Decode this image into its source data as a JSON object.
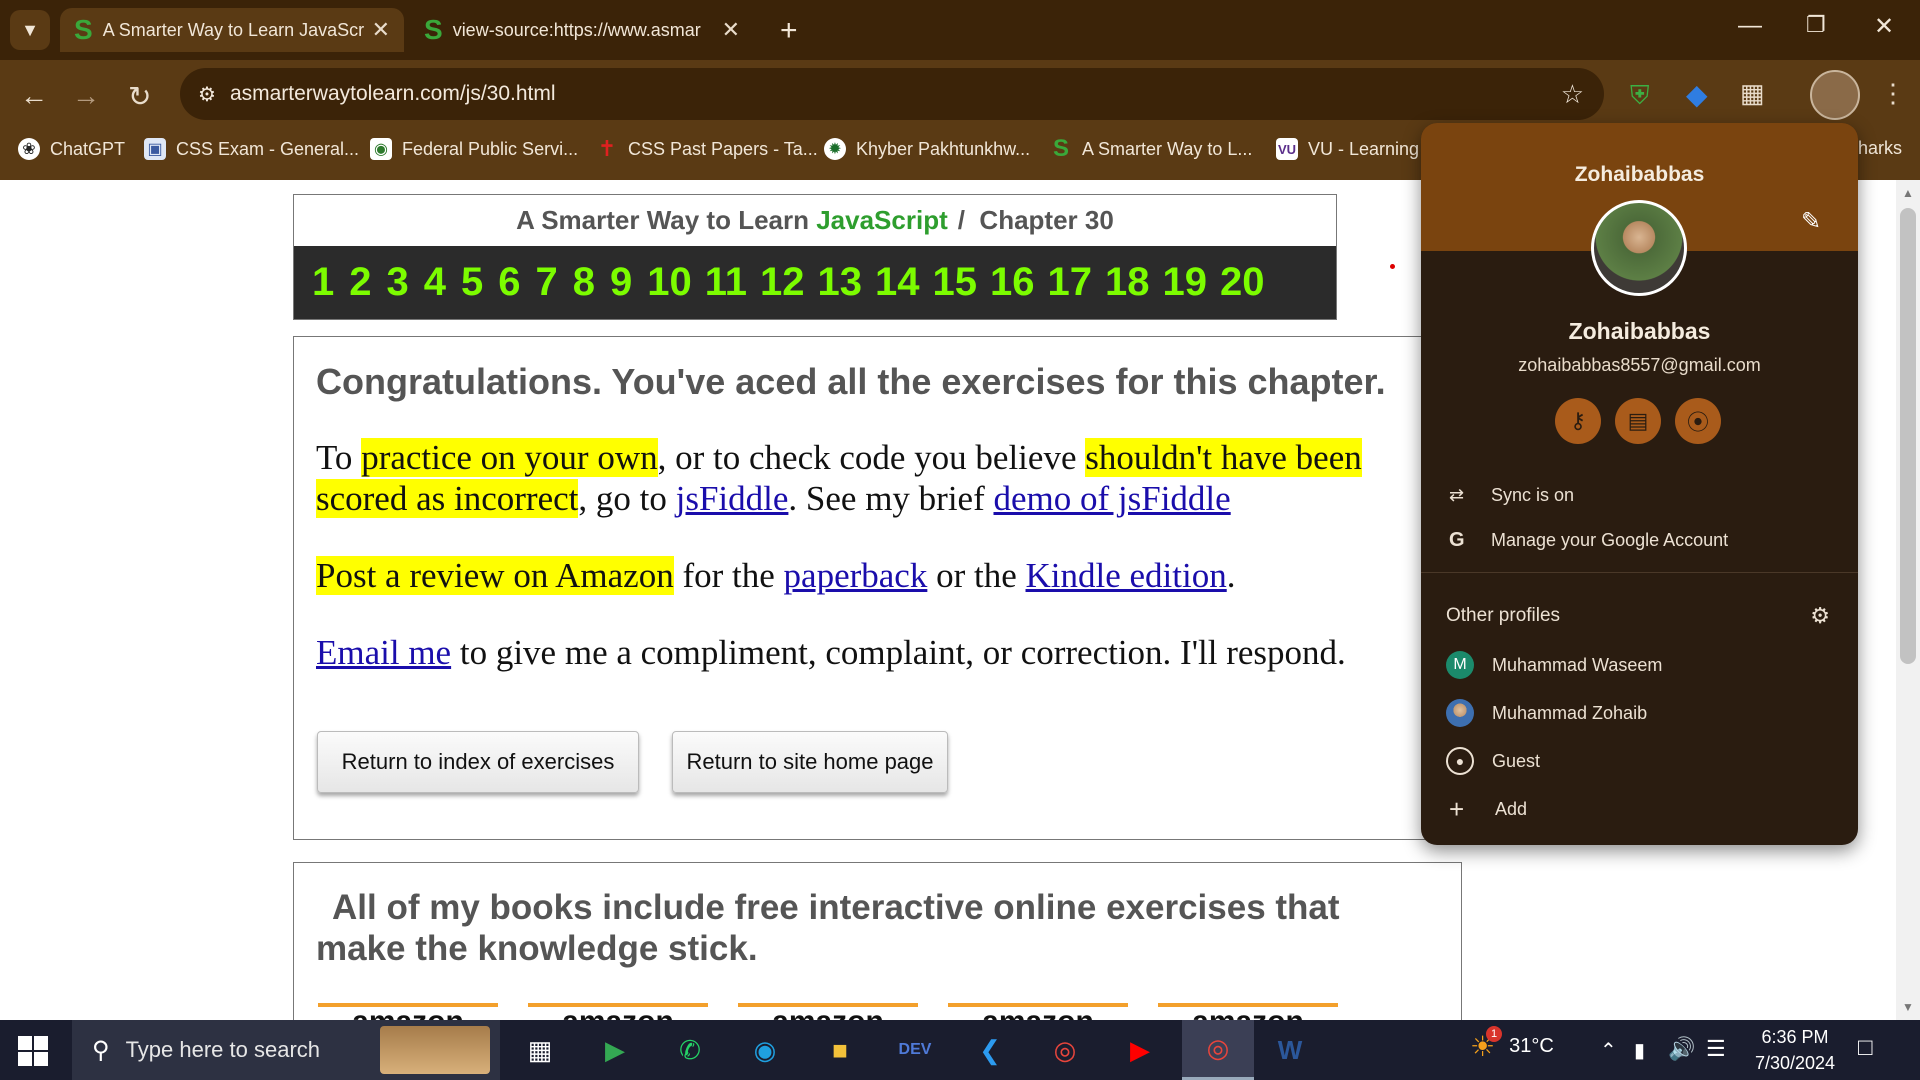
{
  "tabs": [
    {
      "title": "A Smarter Way to Learn JavaScr",
      "active": true
    },
    {
      "title": "view-source:https://www.asmar",
      "active": false
    }
  ],
  "toolbar": {
    "url": "asmarterwaytolearn.com/js/30.html",
    "back_icon": "back-arrow-icon",
    "forward_icon": "forward-arrow-icon",
    "reload_icon": "reload-icon"
  },
  "bookmarks": [
    {
      "label": "ChatGPT",
      "icon": "chatgpt-icon"
    },
    {
      "label": "CSS Exam - General...",
      "icon": "book-icon"
    },
    {
      "label": "Federal Public Servi...",
      "icon": "fpsc-icon"
    },
    {
      "label": "CSS Past Papers - Ta...",
      "icon": "pin-icon"
    },
    {
      "label": "Khyber Pakhtunkhw...",
      "icon": "seal-icon"
    },
    {
      "label": "A Smarter Way to L...",
      "icon": "s-icon"
    },
    {
      "label": "VU - Learning",
      "icon": "vu-icon"
    },
    {
      "label": "harks",
      "icon": ""
    }
  ],
  "header": {
    "title_prefix": "A Smarter Way to Learn ",
    "title_js": "JavaScript",
    "title_suffix": "/  Chapter 30",
    "chapters": [
      "1",
      "2",
      "3",
      "4",
      "5",
      "6",
      "7",
      "8",
      "9",
      "10",
      "11",
      "12",
      "13",
      "14",
      "15",
      "16",
      "17",
      "18",
      "19",
      "20"
    ]
  },
  "content": {
    "heading": "Congratulations. You've aced all the exercises for this chapter.",
    "p1_a": "To ",
    "p1_hl1": "practice on your own",
    "p1_b": ", or to check code you believe ",
    "p1_hl2": "shouldn't have been scored as incorrect",
    "p1_c": ", go to ",
    "p1_link1": "jsFiddle",
    "p1_d": ". See my brief ",
    "p1_link2": "demo of jsFiddle",
    "p2_hl": "Post a review on Amazon",
    "p2_a": " for the ",
    "p2_link1": "paperback",
    "p2_b": " or the ",
    "p2_link2": "Kindle edition",
    "p2_c": ".",
    "p3_link": "Email me",
    "p3_a": " to give me a compliment, complaint, or correction. I'll respond.",
    "btn_index": "Return to index of exercises",
    "btn_home": "Return to site home page"
  },
  "books": {
    "heading": "All of my books include free interactive online exercises that make the knowledge stick.",
    "amazon_label": "amazon"
  },
  "profile": {
    "header_name": "Zohaibabbas",
    "name": "Zohaibabbas",
    "email": "zohaibabbas8557@gmail.com",
    "sync": "Sync is on",
    "manage": "Manage your Google Account",
    "other_profiles": "Other profiles",
    "profiles": [
      {
        "initial": "M",
        "name": "Muhammad Waseem"
      },
      {
        "initial": "",
        "name": "Muhammad Zohaib"
      },
      {
        "initial": "",
        "name": "Guest"
      }
    ],
    "add": "Add"
  },
  "taskbar": {
    "search_placeholder": "Type here to search",
    "temperature": "31°C",
    "time": "6:36 PM",
    "date": "7/30/2024",
    "weather_badge": "1"
  },
  "colors": {
    "tabstrip": "#3b2308",
    "toolbar": "#5a3a14",
    "profile_header": "#7a440f",
    "highlight": "#ffff00",
    "chapter_green": "#7cfc00",
    "link": "#1a0dab"
  }
}
